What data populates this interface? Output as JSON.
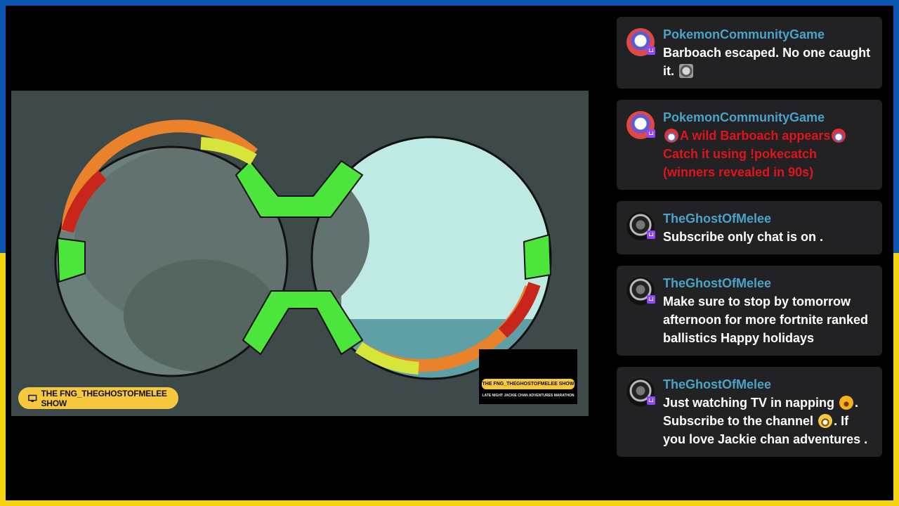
{
  "stream": {
    "show_label": "THE FNG_THEGHOSTOFMELEE SHOW",
    "mini_label": "THE FNG_THEGHOSTOFMELEE SHOW",
    "mini_sublabel": "LATE NIGHT JACKIE CHAN ADVENTURES MARATHON"
  },
  "chat": {
    "messages": [
      {
        "username": "PokemonCommunityGame",
        "text": "Barboach escaped. No one caught it.",
        "emote_after": "snorlax-emote",
        "color": "#ffffff"
      },
      {
        "username": "PokemonCommunityGame",
        "text_before": "A wild Barboach appears",
        "text_after": "Catch it using !pokecatch (winners revealed in 90s)",
        "emote": "santa-emote",
        "color": "#e0141a"
      },
      {
        "username": "TheGhostOfMelee",
        "text": "Subscribe only chat is on .",
        "color": "#ffffff"
      },
      {
        "username": "TheGhostOfMelee",
        "text": "Make sure to stop by tomorrow afternoon for more fortnite ranked ballistics Happy holidays",
        "color": "#ffffff"
      },
      {
        "username": "TheGhostOfMelee",
        "text_a": "Just watching TV in napping",
        "text_b": ". Subscribe to the channel",
        "text_c": ". If you love Jackie chan adventures .",
        "emote_a": "yawn-emote",
        "emote_b": "grin-emote",
        "color": "#ffffff"
      }
    ]
  },
  "colors": {
    "username": "#4aa3c8",
    "bubble": "#222224",
    "pill": "#f6c840",
    "top_band": "#0a55b0",
    "bottom_band": "#f5d313"
  }
}
